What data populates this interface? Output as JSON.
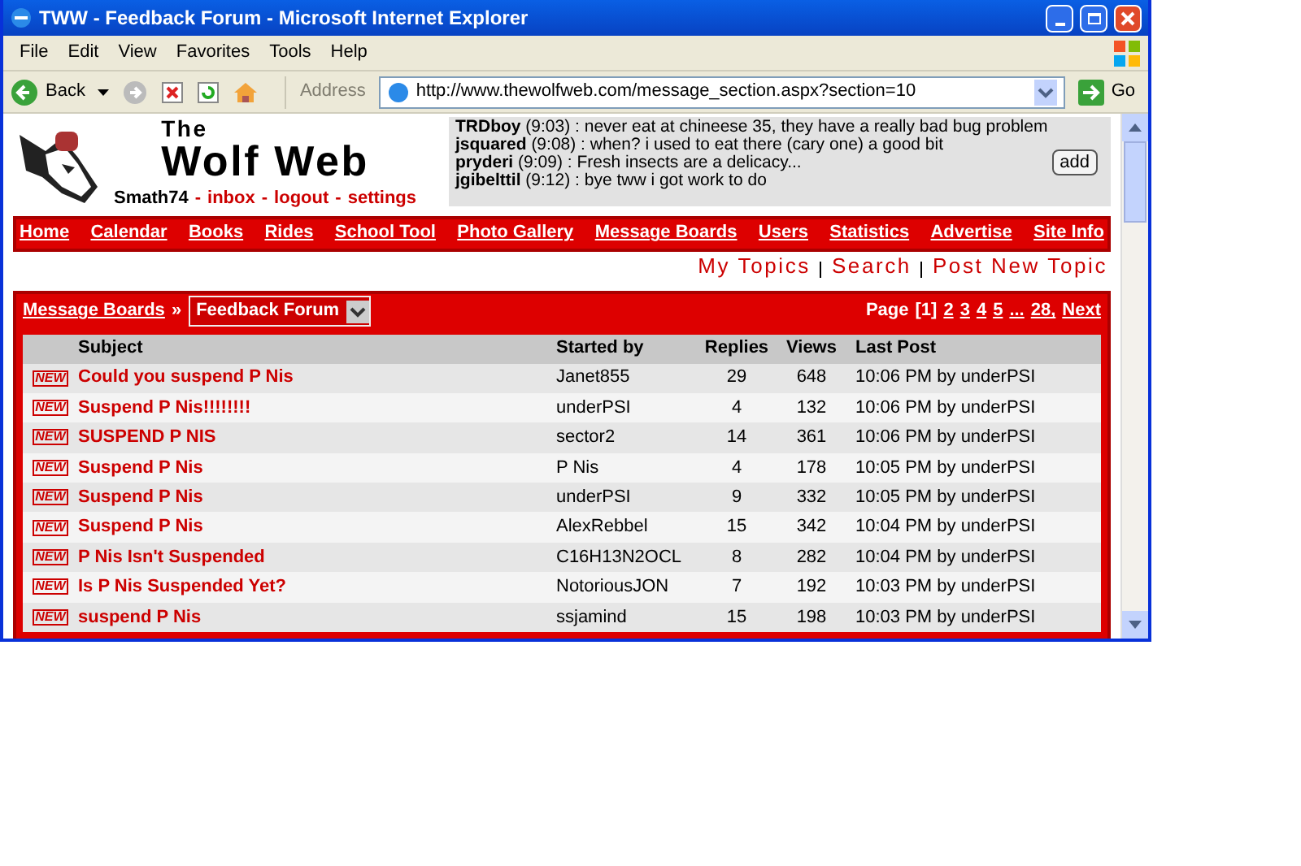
{
  "window": {
    "title": "TWW - Feedback Forum - Microsoft Internet Explorer"
  },
  "menu": [
    "File",
    "Edit",
    "View",
    "Favorites",
    "Tools",
    "Help"
  ],
  "toolbar": {
    "back": "Back",
    "address_label": "Address",
    "address": "http://www.thewolfweb.com/message_section.aspx?section=10",
    "go": "Go"
  },
  "site": {
    "logo_top": "The",
    "logo_main": "Wolf Web",
    "user": "Smath74",
    "user_links": [
      "inbox",
      "logout",
      "settings"
    ],
    "separator": "-"
  },
  "shoutbox": {
    "messages": [
      {
        "user": "TRDboy",
        "time": "(9:03)",
        "text": ": never eat at chineese 35, they have a really bad bug problem"
      },
      {
        "user": "jsquared",
        "time": "(9:08)",
        "text": ": when? i used to eat there (cary one) a good bit"
      },
      {
        "user": "pryderi",
        "time": "(9:09)",
        "text": ": Fresh insects are a delicacy..."
      },
      {
        "user": "jgibelttil",
        "time": "(9:12)",
        "text": ": bye tww i got work to do"
      }
    ],
    "button": "add"
  },
  "nav": [
    "Home",
    "Calendar",
    "Books",
    "Rides",
    "School Tool",
    "Photo Gallery",
    "Message Boards",
    "Users",
    "Statistics",
    "Advertise",
    "Site Info"
  ],
  "sub_nav": [
    "My Topics",
    "Search",
    "Post New Topic"
  ],
  "forum": {
    "breadcrumb": "Message Boards",
    "breadcrumb_sep": "»",
    "section": "Feedback Forum",
    "pager_label": "Page",
    "pages": [
      {
        "label": "[1]",
        "selected": true
      },
      {
        "label": "2",
        "selected": false
      },
      {
        "label": "3",
        "selected": false
      },
      {
        "label": "4",
        "selected": false
      },
      {
        "label": "5",
        "selected": false
      },
      {
        "label": "...",
        "selected": false
      },
      {
        "label": "28,",
        "selected": false
      },
      {
        "label": "Next",
        "selected": false
      }
    ],
    "columns": [
      "Subject",
      "Started by",
      "Replies",
      "Views",
      "Last Post"
    ],
    "rows": [
      {
        "badge": "NEW",
        "subject": "Could you suspend P Nis",
        "starter": "Janet855",
        "replies": "29",
        "views": "648",
        "last": "10:06 PM by underPSI"
      },
      {
        "badge": "NEW",
        "subject": "Suspend P Nis!!!!!!!!",
        "starter": "underPSI",
        "replies": "4",
        "views": "132",
        "last": "10:06 PM by underPSI"
      },
      {
        "badge": "NEW",
        "subject": "SUSPEND P NIS",
        "starter": "sector2",
        "replies": "14",
        "views": "361",
        "last": "10:06 PM by underPSI"
      },
      {
        "badge": "NEW",
        "subject": "Suspend P Nis",
        "starter": "P Nis",
        "replies": "4",
        "views": "178",
        "last": "10:05 PM by underPSI"
      },
      {
        "badge": "NEW",
        "subject": "Suspend P Nis",
        "starter": "underPSI",
        "replies": "9",
        "views": "332",
        "last": "10:05 PM by underPSI"
      },
      {
        "badge": "NEW",
        "subject": "Suspend P Nis",
        "starter": "AlexRebbel",
        "replies": "15",
        "views": "342",
        "last": "10:04 PM by underPSI"
      },
      {
        "badge": "NEW",
        "subject": "P Nis Isn't Suspended",
        "starter": "C16H13N2OCL",
        "replies": "8",
        "views": "282",
        "last": "10:04 PM by underPSI"
      },
      {
        "badge": "NEW",
        "subject": "Is P Nis Suspended Yet?",
        "starter": "NotoriousJON",
        "replies": "7",
        "views": "192",
        "last": "10:03 PM by underPSI"
      },
      {
        "badge": "NEW",
        "subject": "suspend P Nis",
        "starter": "ssjamind",
        "replies": "15",
        "views": "198",
        "last": "10:03 PM by underPSI"
      }
    ]
  }
}
